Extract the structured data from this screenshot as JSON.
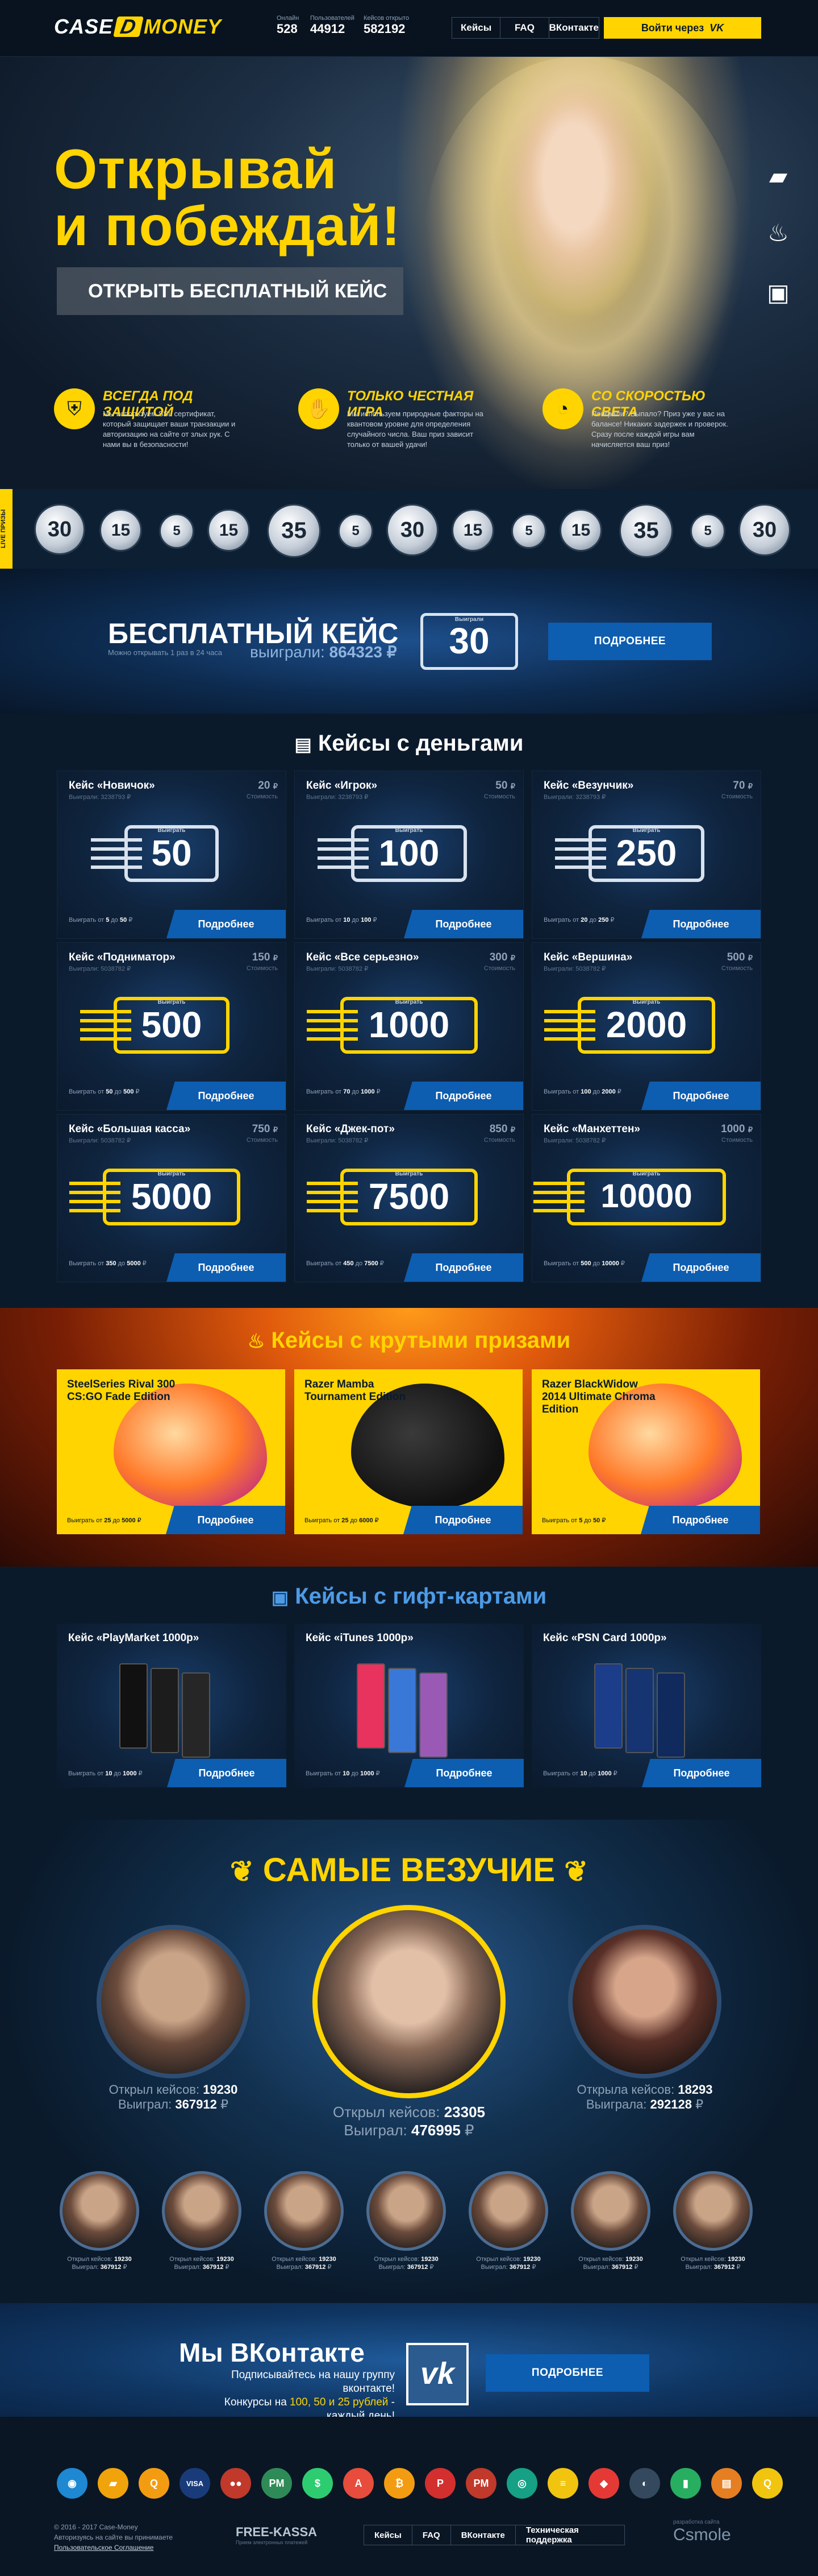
{
  "header": {
    "logo_left": "CASE",
    "logo_mid": "D",
    "logo_right": "MONEY",
    "stats": [
      {
        "label": "Онлайн",
        "value": "528"
      },
      {
        "label": "Пользователей",
        "value": "44912"
      },
      {
        "label": "Кейсов открыто",
        "value": "582192"
      }
    ],
    "nav": [
      "Кейсы",
      "FAQ",
      "ВКонтакте"
    ],
    "login": "Войти через",
    "login_icon": "vk-icon"
  },
  "hero": {
    "title1": "Открывай",
    "title2": "и побеждай!",
    "free_btn": "Открыть бесплатный кейс",
    "side_icons": [
      "wallet-icon",
      "fire-icon",
      "gift-icon"
    ],
    "features": [
      {
        "title": "Всегда под защитой",
        "text": "Мы используем SSL сертификат, который защищает ваши транзакции и авторизацию на сайте от злых рук. С нами вы в безопасности!",
        "icon": "shield-icon"
      },
      {
        "title": "Только честная игра",
        "text": "Мы используем природные факторы на квантовом уровне для определения случайного числа. Ваш приз зависит только от вашей удачи!",
        "icon": "handshake-icon"
      },
      {
        "title": "Со скоростью света",
        "text": "Поиграли? Выпало? Приз уже у вас на балансе! Никаких задержек и проверок. Сразу после каждой игры вам начисляется ваш приз!",
        "icon": "speed-icon"
      }
    ]
  },
  "ticker": {
    "live_label": "LIVE ПРИЗЫ",
    "coins": [
      "30",
      "15",
      "5",
      "15",
      "35",
      "5",
      "30",
      "15",
      "5",
      "15",
      "35",
      "5",
      "30"
    ]
  },
  "free_case": {
    "title": "Бесплатный кейс",
    "sub": "Можно открывать 1 раз в 24 часа",
    "won_label": "выиграли:",
    "won_value": "864323 ₽",
    "case_value": "30",
    "case_caption": "Выиграли",
    "button": "Подробнее"
  },
  "money": {
    "title": "Кейсы с деньгами",
    "title_icon": "money-icon",
    "cards": [
      {
        "name": "Кейс «Новичок»",
        "price": "20",
        "price_unit": "₽",
        "sub": "Выиграли: 3238793 ₽",
        "sub2": "Стоимость",
        "value": "50",
        "win_from": "5",
        "win_to": "50"
      },
      {
        "name": "Кейс «Игрок»",
        "price": "50",
        "price_unit": "₽",
        "sub": "Выиграли: 3238793 ₽",
        "sub2": "Стоимость",
        "value": "100",
        "win_from": "10",
        "win_to": "100"
      },
      {
        "name": "Кейс «Везунчик»",
        "price": "70",
        "price_unit": "₽",
        "sub": "Выиграли: 3238793 ₽",
        "sub2": "Стоимость",
        "value": "250",
        "win_from": "20",
        "win_to": "250"
      },
      {
        "name": "Кейс «Подниматор»",
        "price": "150",
        "price_unit": "₽",
        "sub": "Выиграли: 5038782 ₽",
        "sub2": "Стоимость",
        "value": "500",
        "win_from": "50",
        "win_to": "500"
      },
      {
        "name": "Кейс «Все серьезно»",
        "price": "300",
        "price_unit": "₽",
        "sub": "Выиграли: 5038782 ₽",
        "sub2": "Стоимость",
        "value": "1000",
        "win_from": "70",
        "win_to": "1000"
      },
      {
        "name": "Кейс «Вершина»",
        "price": "500",
        "price_unit": "₽",
        "sub": "Выиграли: 5038782 ₽",
        "sub2": "Стоимость",
        "value": "2000",
        "win_from": "100",
        "win_to": "2000"
      },
      {
        "name": "Кейс «Большая касса»",
        "price": "750",
        "price_unit": "₽",
        "sub": "Выиграли: 5038782 ₽",
        "sub2": "Стоимость",
        "value": "5000",
        "win_from": "350",
        "win_to": "5000"
      },
      {
        "name": "Кейс «Джек-пот»",
        "price": "850",
        "price_unit": "₽",
        "sub": "Выиграли: 5038782 ₽",
        "sub2": "Стоимость",
        "value": "7500",
        "win_from": "450",
        "win_to": "7500"
      },
      {
        "name": "Кейс «Манхеттен»",
        "price": "1000",
        "price_unit": "₽",
        "sub": "Выиграли: 5038782 ₽",
        "sub2": "Стоимость",
        "value": "10000",
        "win_from": "500",
        "win_to": "10000"
      }
    ],
    "win_prefix": "Выиграть от",
    "win_mid": "до",
    "win_suffix": "₽",
    "case_caption": "Выиграть",
    "button": "Подробнее"
  },
  "prizes": {
    "title": "Кейсы с крутыми призами",
    "title_icon": "fire-icon",
    "cards": [
      {
        "name": "SteelSeries Rival 300 CS:GO Fade Edition",
        "win_from": "25",
        "win_to": "5000"
      },
      {
        "name": "Razer Mamba Tournament Edition",
        "win_from": "25",
        "win_to": "6000"
      },
      {
        "name": "Razer BlackWidow 2014 Ultimate Chroma Edition",
        "win_from": "5",
        "win_to": "50"
      }
    ],
    "button": "Подробнее"
  },
  "gifts": {
    "title": "Кейсы с гифт-картами",
    "title_icon": "gift-icon",
    "cards": [
      {
        "name": "Кейс «PlayMarket 1000р»",
        "win_from": "10",
        "win_to": "1000"
      },
      {
        "name": "Кейс «iTunes 1000р»",
        "win_from": "10",
        "win_to": "1000"
      },
      {
        "name": "Кейс «PSN Card 1000р»",
        "win_from": "10",
        "win_to": "1000"
      }
    ],
    "button": "Подробнее"
  },
  "lucky": {
    "title": "Самые везучие",
    "opened_label": "Открыл кейсов:",
    "won_label": "Выиграл:",
    "opened_label_f": "Открыла кейсов:",
    "won_label_f": "Выиграла:",
    "currency": "₽",
    "top": [
      {
        "opened": "19230",
        "won": "367912"
      },
      {
        "opened": "23305",
        "won": "476995"
      },
      {
        "opened": "18293",
        "won": "292128"
      }
    ],
    "small": [
      {
        "opened": "19230",
        "won": "367912"
      },
      {
        "opened": "19230",
        "won": "367912"
      },
      {
        "opened": "19230",
        "won": "367912"
      },
      {
        "opened": "19230",
        "won": "367912"
      },
      {
        "opened": "19230",
        "won": "367912"
      },
      {
        "opened": "19230",
        "won": "367912"
      },
      {
        "opened": "19230",
        "won": "367912"
      }
    ]
  },
  "vk": {
    "title": "Мы ВКонтакте",
    "line1": "Подписывайтесь на нашу группу вконтакте!",
    "line2_pre": "Конкурсы на ",
    "line2_hi": "100, 50 и 25 рублей",
    "line2_post": " - каждый день!",
    "logo": "vk",
    "button": "Подробнее"
  },
  "footer": {
    "copyright": "© 2016 - 2017 Case-Money",
    "rights": "Авторизуясь на сайте вы принимаете",
    "terms": "Пользовательское Соглашение",
    "freekassa": "FREE-KASSA",
    "freekassa_sub": "Прием электронных платежей",
    "nav": [
      "Кейсы",
      "FAQ",
      "ВКонтакте",
      "Техническая поддержка"
    ],
    "dev_label": "разработка сайта",
    "dev": "Csmole",
    "pay_icons": [
      {
        "name": "webmoney-icon",
        "glyph": "◉",
        "bg": "#1e88d2"
      },
      {
        "name": "yandex-money-icon",
        "glyph": "▰",
        "bg": "#f0a30a"
      },
      {
        "name": "qiwi-icon",
        "glyph": "Q",
        "bg": "#f39c12"
      },
      {
        "name": "visa-icon",
        "glyph": "VISA",
        "bg": "#1a3b7a"
      },
      {
        "name": "mastercard-icon",
        "glyph": "●●",
        "bg": "#c0392b"
      },
      {
        "name": "perfect-money-icon",
        "glyph": "PM",
        "bg": "#2e8b57"
      },
      {
        "name": "sberbank-icon",
        "glyph": "$",
        "bg": "#2ecc71"
      },
      {
        "name": "alfa-bank-icon",
        "glyph": "A",
        "bg": "#e74c3c"
      },
      {
        "name": "bitcoin-icon",
        "glyph": "₿",
        "bg": "#f39c12"
      },
      {
        "name": "payeer-icon",
        "glyph": "P",
        "bg": "#d32f2f"
      },
      {
        "name": "pm-icon",
        "glyph": "PM",
        "bg": "#c0392b"
      },
      {
        "name": "okpay-icon",
        "glyph": "◎",
        "bg": "#16a085"
      },
      {
        "name": "beeline-icon",
        "glyph": "≡",
        "bg": "#f1c40f"
      },
      {
        "name": "mts-icon",
        "glyph": "◆",
        "bg": "#e53935"
      },
      {
        "name": "tele2-icon",
        "glyph": "◐",
        "bg": "#34495e"
      },
      {
        "name": "megafon-icon",
        "glyph": "▮",
        "bg": "#27ae60"
      },
      {
        "name": "bank-icon",
        "glyph": "▤",
        "bg": "#e67e22"
      },
      {
        "name": "qiwi2-icon",
        "glyph": "Q",
        "bg": "#f1c40f"
      }
    ]
  }
}
